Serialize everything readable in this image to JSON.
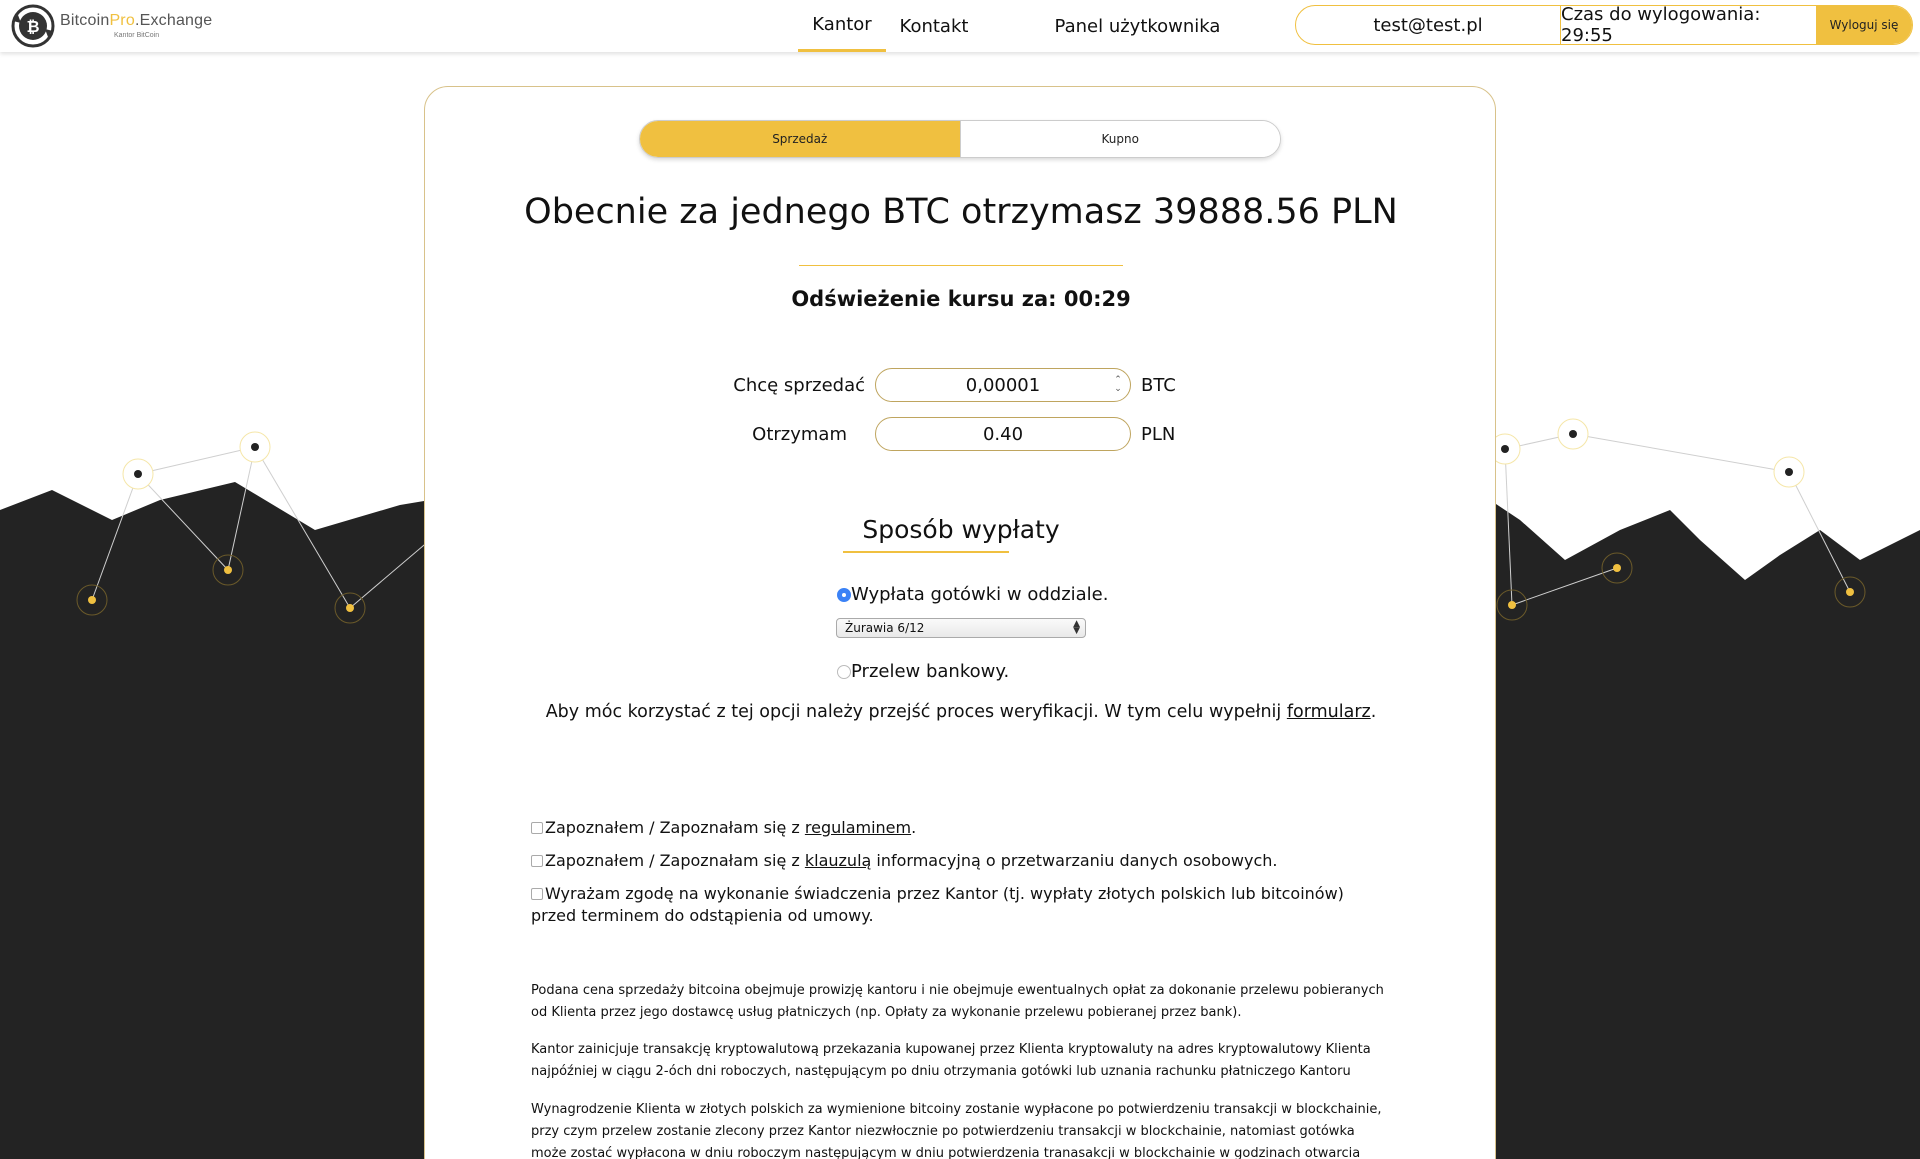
{
  "header": {
    "logo": {
      "main_prefix": "Bitcoin",
      "main_pro": "Pro",
      "main_suffix": ".Exchange",
      "sub": "Kantor BitCoin"
    },
    "nav": {
      "kantor": "Kantor",
      "kontakt": "Kontakt",
      "panel": "Panel użytkownika"
    },
    "user_email": "test@test.pl",
    "logout_timer": "Czas do wylogowania: 29:55",
    "logout_button": "Wyloguj się"
  },
  "tabs": {
    "sell": "Sprzedaż",
    "buy": "Kupno",
    "active": "sell"
  },
  "headline": "Obecnie za jednego BTC otrzymasz 39888.56 PLN",
  "refresh": "Odświeżenie kursu za: 00:29",
  "form": {
    "sell_label": "Chcę sprzedać",
    "sell_value": "0,00001",
    "sell_unit": "BTC",
    "receive_label": "Otrzymam",
    "receive_value": "0.40",
    "receive_unit": "PLN"
  },
  "payout": {
    "title": "Sposób wypłaty",
    "cash_label": "Wypłata gotówki w oddziale.",
    "cash_checked": true,
    "branch_selected": "Żurawia 6/12",
    "transfer_label": "Przelew bankowy.",
    "transfer_checked": false,
    "verification_text": "Aby móc korzystać z tej opcji należy przejść proces weryfikacji. W tym celu wypełnij ",
    "verification_link": "formularz",
    "verification_end": "."
  },
  "consents": {
    "c1_before": "Zapoznałem / Zapoznałam się z ",
    "c1_link": "regulaminem",
    "c1_after": ".",
    "c2_before": "Zapoznałem / Zapoznałam się z ",
    "c2_link": "klauzulą",
    "c2_after": " informacyjną o przetwarzaniu danych osobowych.",
    "c3": "Wyrażam zgodę na wykonanie świadczenia przez Kantor (tj. wypłaty złotych polskich lub bitcoinów) przed terminem do odstąpienia od umowy."
  },
  "fine_print": {
    "p1": "Podana cena sprzedaży bitcoina obejmuje prowizję kantoru i nie obejmuje ewentualnych opłat za dokonanie przelewu pobieranych od Klienta przez jego dostawcę usług płatniczych (np. Opłaty za wykonanie przelewu pobieranej przez bank).",
    "p2": "Kantor zainicjuje transakcję kryptowalutową przekazania kupowanej przez Klienta kryptowaluty na adres kryptowalutowy Klienta najpóźniej w ciągu 2-óch dni roboczych, następującym po dniu otrzymania gotówki lub uznania rachunku płatniczego Kantoru",
    "p3": "Wynagrodzenie Klienta w złotych polskich za wymienione bitcoiny zostanie wypłacone po potwierdzeniu transakcji w blockchainie, przy czym przelew zostanie zlecony przez Kantor niezwłocznie po potwierdzeniu transakcji w blockchainie, natomiast gotówka może zostać wypłacona w dniu roboczym następującym w dniu potwierdzenia tranasakcji w blockchainie w godzinach otwarcia kantoru stacjonarnego."
  },
  "colors": {
    "accent": "#f0c040",
    "dark_bg": "#232323",
    "radio_checked": "#3b82f6"
  }
}
